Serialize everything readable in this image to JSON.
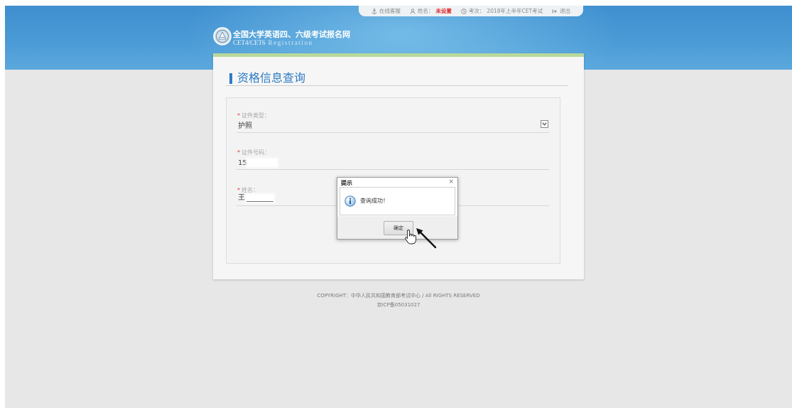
{
  "header": {
    "topbar": {
      "service": {
        "icon": "anchor-icon",
        "label": "在线客服"
      },
      "name": {
        "icon": "user-icon",
        "label": "姓名：",
        "value": "未设置"
      },
      "session": {
        "icon": "clock-icon",
        "label": "考次：",
        "value": "2018年上半年CET考试"
      },
      "logout": {
        "icon": "logout-icon",
        "label": "退出"
      }
    },
    "logo": {
      "title": "全国大学英语四、六级考试报名网",
      "subtitle_cet": "CET4/CET6",
      "subtitle_reg": "Registration"
    }
  },
  "page": {
    "title": "资格信息查询"
  },
  "form": {
    "id_type": {
      "required_mark": "*",
      "label": "证件类型：",
      "value": "护照"
    },
    "id_number": {
      "required_mark": "*",
      "label": "证件号码：",
      "value": "15"
    },
    "name": {
      "required_mark": "*",
      "label": "姓名：",
      "value": "王"
    }
  },
  "dialog": {
    "title": "提示",
    "close": "×",
    "icon": "info-icon",
    "message": "查询成功！",
    "ok": "确定"
  },
  "footer": {
    "copyright": "COPYRIGHT：中华人民共和国教育部考试中心 / All RIGHTS RESERVED",
    "icp": "京ICP备05031027"
  },
  "colors": {
    "header_blue": "#3f8fd0",
    "accent_blue": "#2e7bc4",
    "card_top_green": "#b8d99c",
    "required_red": "#e03a3a",
    "unset_red": "#e0282a"
  }
}
